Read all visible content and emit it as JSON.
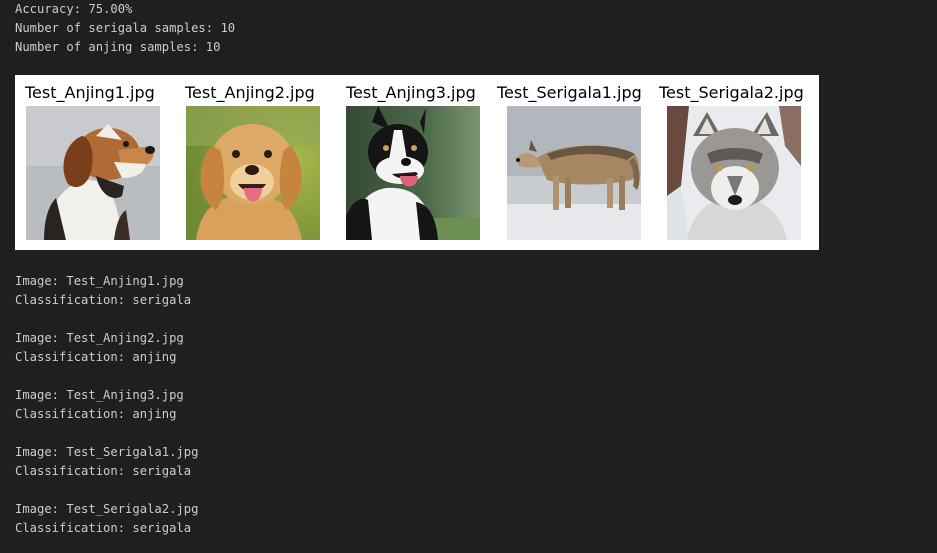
{
  "summary": {
    "accuracy": "Accuracy: 75.00%",
    "serigala_samples": "Number of serigala samples: 10",
    "anjing_samples": "Number of anjing samples: 10"
  },
  "figure": {
    "images": [
      {
        "title": "Test_Anjing1.jpg",
        "icon": "beagle-dog-photo"
      },
      {
        "title": "Test_Anjing2.jpg",
        "icon": "golden-retriever-dog-photo"
      },
      {
        "title": "Test_Anjing3.jpg",
        "icon": "border-collie-dog-photo"
      },
      {
        "title": "Test_Serigala1.jpg",
        "icon": "wolf-walking-in-snow-photo"
      },
      {
        "title": "Test_Serigala2.jpg",
        "icon": "gray-wolf-portrait-photo"
      }
    ]
  },
  "results": [
    {
      "image": "Image: Test_Anjing1.jpg",
      "classification": "Classification: serigala"
    },
    {
      "image": "Image: Test_Anjing2.jpg",
      "classification": "Classification: anjing"
    },
    {
      "image": "Image: Test_Anjing3.jpg",
      "classification": "Classification: anjing"
    },
    {
      "image": "Image: Test_Serigala1.jpg",
      "classification": "Classification: serigala"
    },
    {
      "image": "Image: Test_Serigala2.jpg",
      "classification": "Classification: serigala"
    }
  ],
  "colors": {
    "background": "#1f1f1f",
    "text": "#cccccc",
    "figure_background": "#ffffff"
  }
}
